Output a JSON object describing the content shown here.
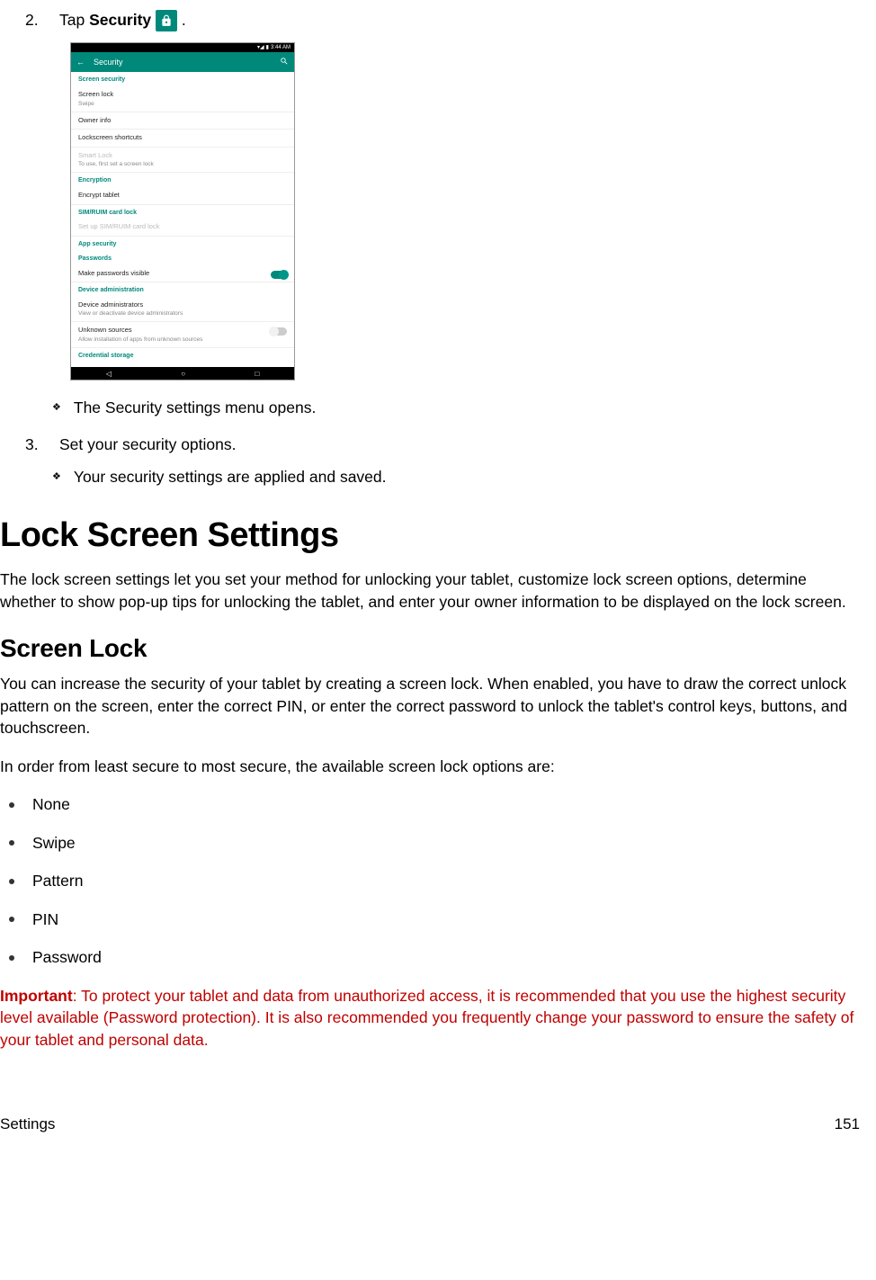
{
  "step2": {
    "num": "2.",
    "pre": "Tap ",
    "bold": "Security",
    "post": " ."
  },
  "phone": {
    "time": "3:44 AM",
    "title": "Security",
    "sections": {
      "s1": "Screen security",
      "i1t": "Screen lock",
      "i1s": "Swipe",
      "i2t": "Owner info",
      "i3t": "Lockscreen shortcuts",
      "i4t": "Smart Lock",
      "i4s": "To use, first set a screen lock",
      "s2": "Encryption",
      "i5t": "Encrypt tablet",
      "s3": "SIM/RUIM card lock",
      "i6t": "Set up SIM/RUIM card lock",
      "s4": "App security",
      "s5": "Passwords",
      "i7t": "Make passwords visible",
      "s6": "Device administration",
      "i8t": "Device administrators",
      "i8s": "View or deactivate device administrators",
      "i9t": "Unknown sources",
      "i9s": "Allow installation of apps from unknown sources",
      "s7": "Credential storage"
    }
  },
  "bullets": {
    "b1": "The Security settings menu opens.",
    "b2": "Your security settings are applied and saved."
  },
  "step3": {
    "num": "3.",
    "text": "Set your security options."
  },
  "h1": "Lock Screen Settings",
  "p1": "The lock screen settings let you set your method for unlocking your tablet, customize lock screen options, determine whether to show pop-up tips for unlocking the tablet, and enter your owner information to be displayed on the lock screen.",
  "h2": "Screen Lock",
  "p2": "You can increase the security of your tablet by creating a screen lock. When enabled, you have to draw the correct unlock pattern on the screen, enter the correct PIN, or enter the correct password to unlock the tablet's control keys, buttons, and touchscreen.",
  "p3": "In order from least secure to most secure, the available screen lock options are:",
  "opts": {
    "o1": "None",
    "o2": "Swipe",
    "o3": "Pattern",
    "o4": "PIN",
    "o5": "Password"
  },
  "important": {
    "label": "Important",
    "text": ": To protect your tablet and data from unauthorized access, it is recommended that you use the highest security level available (Password protection). It is also recommended you frequently change your password to ensure the safety of your tablet and personal data."
  },
  "footer": {
    "left": "Settings",
    "right": "151"
  }
}
